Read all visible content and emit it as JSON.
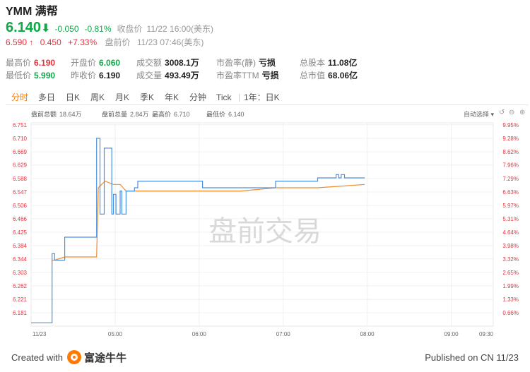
{
  "header": {
    "title": "YMM 满帮",
    "price": "6.140",
    "change": "-0.050",
    "change_pct": "-0.81%",
    "close_label": "收盘价",
    "close_time": "11/22 16:00(美东)",
    "pre_price": "6.590",
    "pre_arrow": "↑",
    "pre_change": "0.450",
    "pre_change_pct": "+7.33%",
    "pre_label": "盘前价",
    "pre_time": "11/23 07:46(美东)"
  },
  "stats": [
    {
      "label": "最高价",
      "value": "6.190",
      "color": "red"
    },
    {
      "label": "开盘价",
      "value": "6.060",
      "color": "green"
    },
    {
      "label": "成交额",
      "value": "3008.1万",
      "color": "dark"
    },
    {
      "label": "市盈率(静)",
      "value": "亏损",
      "color": "dark"
    },
    {
      "label": "总股本",
      "value": "11.08亿",
      "color": "dark"
    },
    {
      "label": "最低价",
      "value": "5.990",
      "color": "green"
    },
    {
      "label": "昨收价",
      "value": "6.190",
      "color": "dark"
    },
    {
      "label": "成交量",
      "value": "493.49万",
      "color": "dark"
    },
    {
      "label": "市盈率TTM",
      "value": "亏损",
      "color": "dark"
    },
    {
      "label": "总市值",
      "value": "68.06亿",
      "color": "dark"
    }
  ],
  "tabs": [
    "分时",
    "多日",
    "日K",
    "周K",
    "月K",
    "季K",
    "年K",
    "分钟",
    "Tick",
    "1年：日K"
  ],
  "chart_info": {
    "total_label": "盘前总额",
    "total_value": "18.64万",
    "vol_label": "盘前总量",
    "vol_value": "2.84万",
    "high_label": "最高价",
    "high_value": "6.710",
    "low_label": "最低价",
    "low_value": "6.140",
    "autoselect": "自动选择"
  },
  "colors": {
    "accent": "#ff7a00",
    "up": "#e6323c",
    "down": "#11a84a",
    "price_line": "#4a90e2",
    "avg_line": "#f08c2e"
  },
  "chart_data": {
    "type": "line",
    "title": "",
    "watermark": "盘前交易",
    "y_ticks": [
      "6.751",
      "6.710",
      "6.669",
      "6.629",
      "6.588",
      "6.547",
      "6.506",
      "6.466",
      "6.425",
      "6.384",
      "6.344",
      "6.303",
      "6.262",
      "6.221",
      "6.181"
    ],
    "pct_ticks": [
      "9.95%",
      "9.28%",
      "8.62%",
      "7.96%",
      "7.29%",
      "6.63%",
      "5.97%",
      "5.31%",
      "4.64%",
      "3.98%",
      "3.32%",
      "2.65%",
      "1.99%",
      "1.33%",
      "0.66%"
    ],
    "x_ticks": [
      "11/23",
      "05:00",
      "06:00",
      "07:00",
      "08:00",
      "09:00",
      "09:30"
    ],
    "x_range_hours": [
      4.0,
      9.5
    ],
    "ylim": [
      6.14,
      6.78
    ],
    "series": [
      {
        "kind": "price",
        "x": [
          4.0,
          4.25,
          4.25,
          4.28,
          4.28,
          4.4,
          4.4,
          4.78,
          4.78,
          4.82,
          4.82,
          4.87,
          4.87,
          4.96,
          4.96,
          4.98,
          4.98,
          5.01,
          5.01,
          5.06,
          5.06,
          5.08,
          5.08,
          5.13,
          5.13,
          5.23,
          5.23,
          5.27,
          5.27,
          6.04,
          6.04,
          6.91,
          6.91,
          7.41,
          7.41,
          7.63,
          7.63,
          7.66,
          7.66,
          7.69,
          7.69,
          7.73,
          7.73,
          7.77,
          7.77,
          7.97
        ],
        "y": [
          6.15,
          6.15,
          6.36,
          6.36,
          6.34,
          6.34,
          6.41,
          6.41,
          6.71,
          6.71,
          6.48,
          6.48,
          6.68,
          6.68,
          6.48,
          6.48,
          6.54,
          6.54,
          6.48,
          6.48,
          6.55,
          6.55,
          6.48,
          6.48,
          6.55,
          6.55,
          6.56,
          6.56,
          6.58,
          6.58,
          6.56,
          6.56,
          6.58,
          6.58,
          6.59,
          6.59,
          6.6,
          6.6,
          6.59,
          6.59,
          6.6,
          6.6,
          6.59,
          6.59,
          6.59,
          6.59
        ]
      },
      {
        "kind": "average",
        "x": [
          4.25,
          4.28,
          4.4,
          4.78,
          4.8,
          4.88,
          4.98,
          5.06,
          5.13,
          5.23,
          5.5,
          6.0,
          6.5,
          6.91,
          7.2,
          7.41,
          7.7,
          7.97
        ],
        "y": [
          6.34,
          6.34,
          6.35,
          6.35,
          6.56,
          6.58,
          6.57,
          6.57,
          6.55,
          6.55,
          6.55,
          6.55,
          6.55,
          6.56,
          6.56,
          6.56,
          6.565,
          6.57
        ]
      }
    ]
  },
  "footer": {
    "created_with": "Created with",
    "brand": "富途牛牛",
    "published": "Published on CN 11/23"
  }
}
